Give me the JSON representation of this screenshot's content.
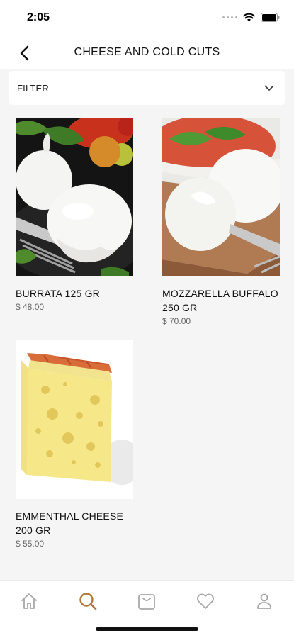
{
  "status": {
    "time": "2:05"
  },
  "nav": {
    "title": "CHEESE AND COLD CUTS"
  },
  "filter": {
    "label": "FILTER"
  },
  "products": [
    {
      "name": "BURRATA 125 GR",
      "price": "$ 48.00"
    },
    {
      "name": "MOZZARELLA BUFFALO 250 GR",
      "price": "$ 70.00"
    },
    {
      "name": "EMMENTHAL CHEESE 200 GR",
      "price": "$ 55.00"
    }
  ],
  "tabs": [
    {
      "icon": "home-icon",
      "active": false
    },
    {
      "icon": "search-icon",
      "active": true
    },
    {
      "icon": "cart-icon",
      "active": false
    },
    {
      "icon": "heart-icon",
      "active": false
    },
    {
      "icon": "profile-icon",
      "active": false
    }
  ],
  "colors": {
    "accent": "#b07a3c",
    "inactive_icon": "#a8a8a8",
    "background": "#f5f5f5"
  }
}
